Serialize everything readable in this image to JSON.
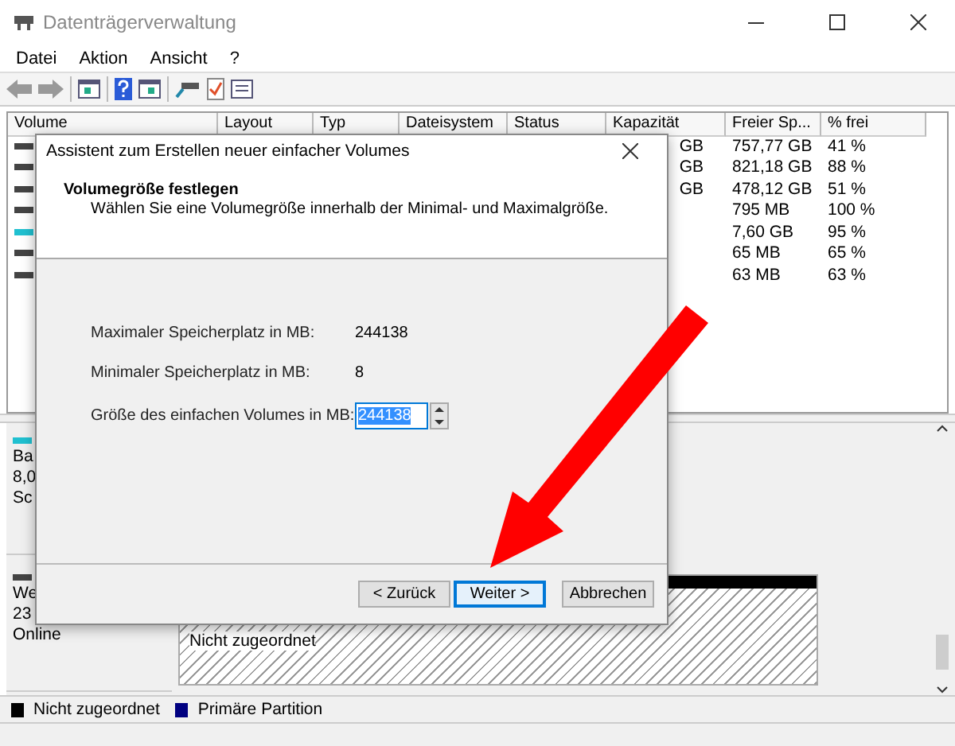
{
  "window": {
    "title": "Datenträgerverwaltung"
  },
  "menu": [
    "Datei",
    "Aktion",
    "Ansicht",
    "?"
  ],
  "table": {
    "columns": [
      "Volume",
      "Layout",
      "Typ",
      "Dateisystem",
      "Status",
      "Kapazität",
      "Freier Sp...",
      "% frei"
    ],
    "rows": [
      {
        "kind": "disk",
        "capacity": "GB",
        "free": "757,77 GB",
        "percent_free": "41 %"
      },
      {
        "kind": "disk",
        "capacity": "GB",
        "free": "821,18 GB",
        "percent_free": "88 %"
      },
      {
        "kind": "disk",
        "capacity": "GB",
        "free": "478,12 GB",
        "percent_free": "51 %"
      },
      {
        "kind": "disk",
        "free": "795 MB",
        "percent_free": "100 %"
      },
      {
        "kind": "removable",
        "free": "7,60 GB",
        "percent_free": "95 %"
      },
      {
        "kind": "disk",
        "free": "65 MB",
        "percent_free": "65 %"
      },
      {
        "kind": "disk",
        "free": "63 MB",
        "percent_free": "63 %"
      }
    ]
  },
  "disks": [
    {
      "kind": "removable",
      "lines": [
        "Ba",
        "8,0",
        "Sc"
      ]
    },
    {
      "kind": "disk",
      "lines": [
        "We",
        "23",
        "Online"
      ],
      "partitions": [
        {
          "kind": "unallocated",
          "label": "Nicht zugeordnet"
        }
      ]
    }
  ],
  "legend": [
    {
      "label": "Nicht zugeordnet",
      "color": "#000000"
    },
    {
      "label": "Primäre Partition",
      "color": "#000080"
    }
  ],
  "dialog": {
    "title": "Assistent zum Erstellen neuer einfacher Volumes",
    "heading": "Volumegröße festlegen",
    "subtitle": "Wählen Sie eine Volumegröße innerhalb der Minimal- und Maximalgröße.",
    "fields": [
      {
        "label": "Maximaler Speicherplatz in MB:",
        "value": "244138"
      },
      {
        "label": "Minimaler Speicherplatz in MB:",
        "value": "8"
      }
    ],
    "size_input": {
      "label": "Größe des einfachen Volumes in MB:",
      "value": "244138",
      "selected": true
    },
    "buttons": [
      {
        "label": "< Zurück",
        "focused": false
      },
      {
        "label": "Weiter >",
        "focused": true
      },
      {
        "label": "Abbrechen",
        "focused": false
      }
    ]
  }
}
